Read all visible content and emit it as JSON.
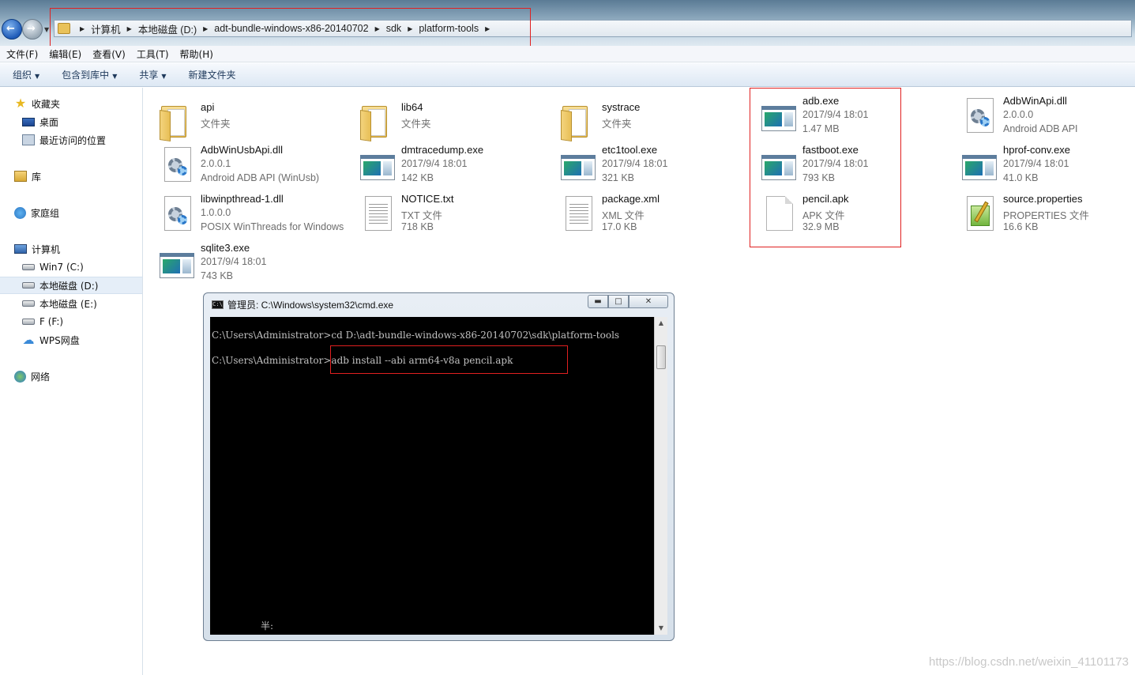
{
  "address_bar": {
    "breadcrumbs": [
      "计算机",
      "本地磁盘 (D:)",
      "adt-bundle-windows-x86-20140702",
      "sdk",
      "platform-tools"
    ]
  },
  "menu": [
    "文件(F)",
    "编辑(E)",
    "查看(V)",
    "工具(T)",
    "帮助(H)"
  ],
  "toolbar": {
    "organize": "组织",
    "include_in_library": "包含到库中",
    "share": "共享",
    "new_folder": "新建文件夹"
  },
  "sidebar": {
    "favorites": "收藏夹",
    "desktop": "桌面",
    "recent": "最近访问的位置",
    "libraries": "库",
    "homegroup": "家庭组",
    "computer": "计算机",
    "drive_c": "Win7 (C:)",
    "drive_d": "本地磁盘 (D:)",
    "drive_e": "本地磁盘 (E:)",
    "drive_f": "F (F:)",
    "wps": "WPS网盘",
    "network": "网络"
  },
  "files": [
    {
      "name": "api",
      "l2": "文件夹",
      "l3": "",
      "icon": "folder-icon"
    },
    {
      "name": "lib64",
      "l2": "文件夹",
      "l3": "",
      "icon": "folder-icon"
    },
    {
      "name": "systrace",
      "l2": "文件夹",
      "l3": "",
      "icon": "folder-icon"
    },
    {
      "name": "adb.exe",
      "l2": "2017/9/4 18:01",
      "l3": "1.47 MB",
      "icon": "exe-icon"
    },
    {
      "name": "AdbWinApi.dll",
      "l2": "2.0.0.0",
      "l3": "Android ADB API",
      "icon": "dll-icon"
    },
    {
      "name": "AdbWinUsbApi.dll",
      "l2": "2.0.0.1",
      "l3": "Android ADB API (WinUsb)",
      "icon": "dll-icon"
    },
    {
      "name": "dmtracedump.exe",
      "l2": "2017/9/4 18:01",
      "l3": "142 KB",
      "icon": "exe-icon"
    },
    {
      "name": "etc1tool.exe",
      "l2": "2017/9/4 18:01",
      "l3": "321 KB",
      "icon": "exe-icon"
    },
    {
      "name": "fastboot.exe",
      "l2": "2017/9/4 18:01",
      "l3": "793 KB",
      "icon": "exe-icon"
    },
    {
      "name": "hprof-conv.exe",
      "l2": "2017/9/4 18:01",
      "l3": "41.0 KB",
      "icon": "exe-icon"
    },
    {
      "name": "libwinpthread-1.dll",
      "l2": "1.0.0.0",
      "l3": "POSIX WinThreads for Windows",
      "icon": "dll-icon"
    },
    {
      "name": "NOTICE.txt",
      "l2": "TXT 文件",
      "l3": "718 KB",
      "icon": "text-file-icon"
    },
    {
      "name": "package.xml",
      "l2": "XML 文件",
      "l3": "17.0 KB",
      "icon": "text-file-icon"
    },
    {
      "name": "pencil.apk",
      "l2": "APK 文件",
      "l3": "32.9 MB",
      "icon": "blank-file-icon"
    },
    {
      "name": "source.properties",
      "l2": "PROPERTIES 文件",
      "l3": "16.6 KB",
      "icon": "properties-file-icon"
    },
    {
      "name": "sqlite3.exe",
      "l2": "2017/9/4 18:01",
      "l3": "743 KB",
      "icon": "exe-icon"
    }
  ],
  "cmd": {
    "title": "管理员: C:\\Windows\\system32\\cmd.exe",
    "line1": "C:\\Users\\Administrator>cd D:\\adt-bundle-windows-x86-20140702\\sdk\\platform-tools",
    "line2": "C:\\Users\\Administrator>adb install --abi arm64-v8a pencil.apk",
    "ime": "半:"
  },
  "watermark": "https://blog.csdn.net/weixin_41101173",
  "colors": {
    "highlight_box": "#e02020",
    "cmd_background": "#000000",
    "cmd_text": "#c0c0c0"
  }
}
